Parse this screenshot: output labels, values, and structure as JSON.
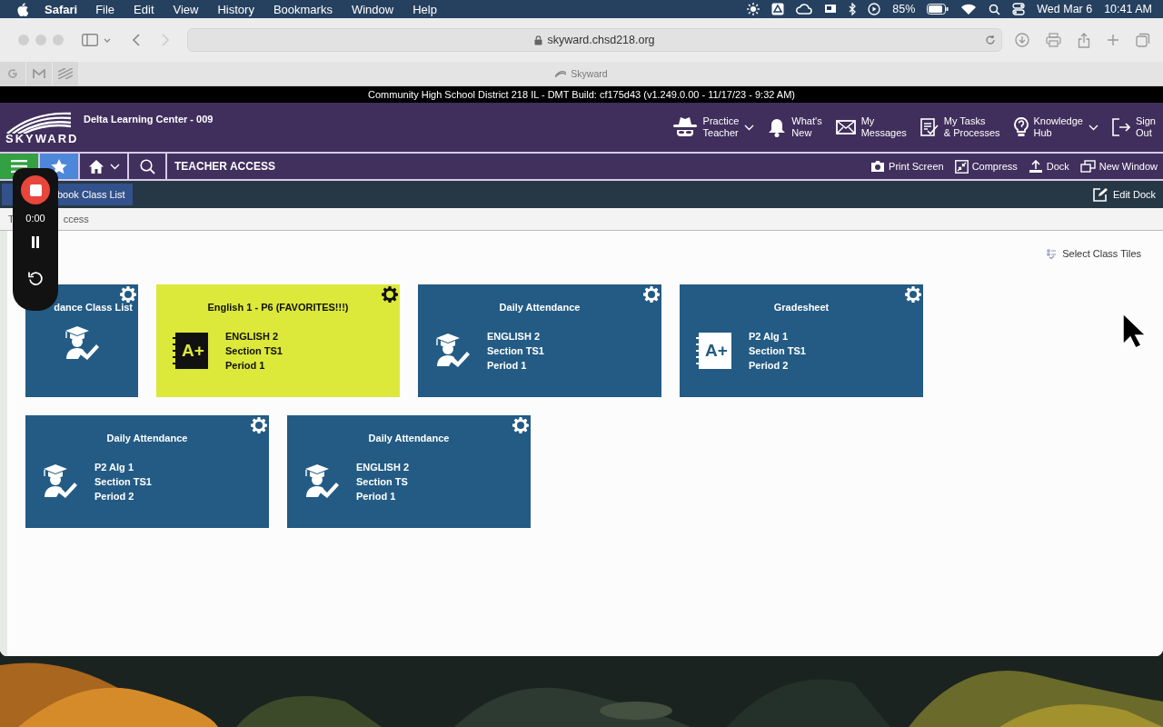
{
  "menubar": {
    "app": "Safari",
    "menus": [
      "File",
      "Edit",
      "View",
      "History",
      "Bookmarks",
      "Window",
      "Help"
    ],
    "battery": "85%",
    "date": "Wed Mar 6",
    "time": "10:41 AM"
  },
  "browser": {
    "url": "skyward.chsd218.org",
    "tab": "Skyward"
  },
  "build_bar": "Community High School District 218 IL - DMT Build: cf175d43 (v1.249.0.00 - 11/17/23 - 9:32 AM)",
  "header": {
    "logo": "SKYWARD",
    "school": "Delta Learning Center - 009",
    "actions": [
      {
        "line1": "Practice",
        "line2": "Teacher",
        "dropdown": true
      },
      {
        "line1": "What's",
        "line2": "New",
        "dropdown": false
      },
      {
        "line1": "My",
        "line2": "Messages",
        "dropdown": false
      },
      {
        "line1": "My Tasks",
        "line2": "& Processes",
        "dropdown": false
      },
      {
        "line1": "Knowledge",
        "line2": "Hub",
        "dropdown": true
      },
      {
        "line1": "Sign",
        "line2": "Out",
        "dropdown": false
      }
    ]
  },
  "nav": {
    "title": "TEACHER ACCESS",
    "tools": [
      "Print Screen",
      "Compress",
      "Dock",
      "New Window"
    ]
  },
  "dock": {
    "tabs": [
      "book Class List"
    ],
    "edit": "Edit Dock"
  },
  "breadcrumb": [
    "T",
    "ccess"
  ],
  "recorder": {
    "time": "0:00"
  },
  "select_tiles": "Select Class Tiles",
  "tiles": [
    {
      "kind": "attendance",
      "title": "dance Class List",
      "color": "#235b84"
    },
    {
      "kind": "gradebook",
      "title": "English 1 - P6 (FAVORITES!!!)",
      "badge": "A+",
      "lines": [
        "ENGLISH 2",
        "Section TS1",
        "Period 1"
      ],
      "color": "#dce83a"
    },
    {
      "kind": "attendance",
      "title": "Daily Attendance",
      "lines": [
        "ENGLISH 2",
        "Section TS1",
        "Period 1"
      ],
      "color": "#235b84"
    },
    {
      "kind": "gradebook",
      "title": "Gradesheet",
      "badge": "A+",
      "lines": [
        "P2 Alg 1",
        "Section TS1",
        "Period 2"
      ],
      "color": "#235b84"
    },
    {
      "kind": "attendance",
      "title": "Daily Attendance",
      "lines": [
        "P2 Alg 1",
        "Section TS1",
        "Period 2"
      ],
      "color": "#235b84"
    },
    {
      "kind": "attendance",
      "title": "Daily Attendance",
      "lines": [
        "ENGLISH 2",
        "Section TS",
        "Period 1"
      ],
      "color": "#235b84"
    }
  ]
}
